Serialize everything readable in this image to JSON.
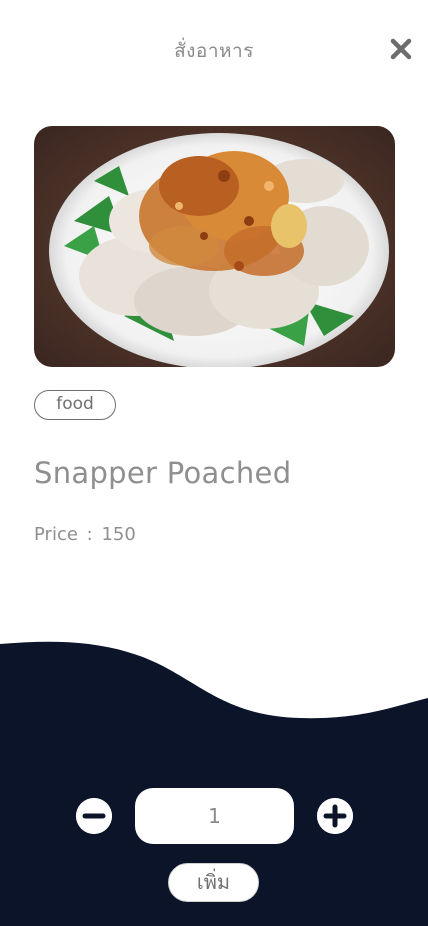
{
  "header": {
    "title": "สั่งอาหาร",
    "close_icon": "close-icon"
  },
  "product": {
    "image": "food-photo-snapper-poached",
    "tag": "food",
    "name": "Snapper Poached",
    "price_label": "Price",
    "price_separator": ":",
    "price": "150"
  },
  "order": {
    "quantity": "1",
    "minus_icon": "minus-circle-icon",
    "plus_icon": "plus-circle-icon",
    "add_label": "เพิ่ม"
  },
  "colors": {
    "bottom_panel": "#0b1428",
    "text_gray": "#8f8f8f",
    "background": "#ffffff"
  }
}
